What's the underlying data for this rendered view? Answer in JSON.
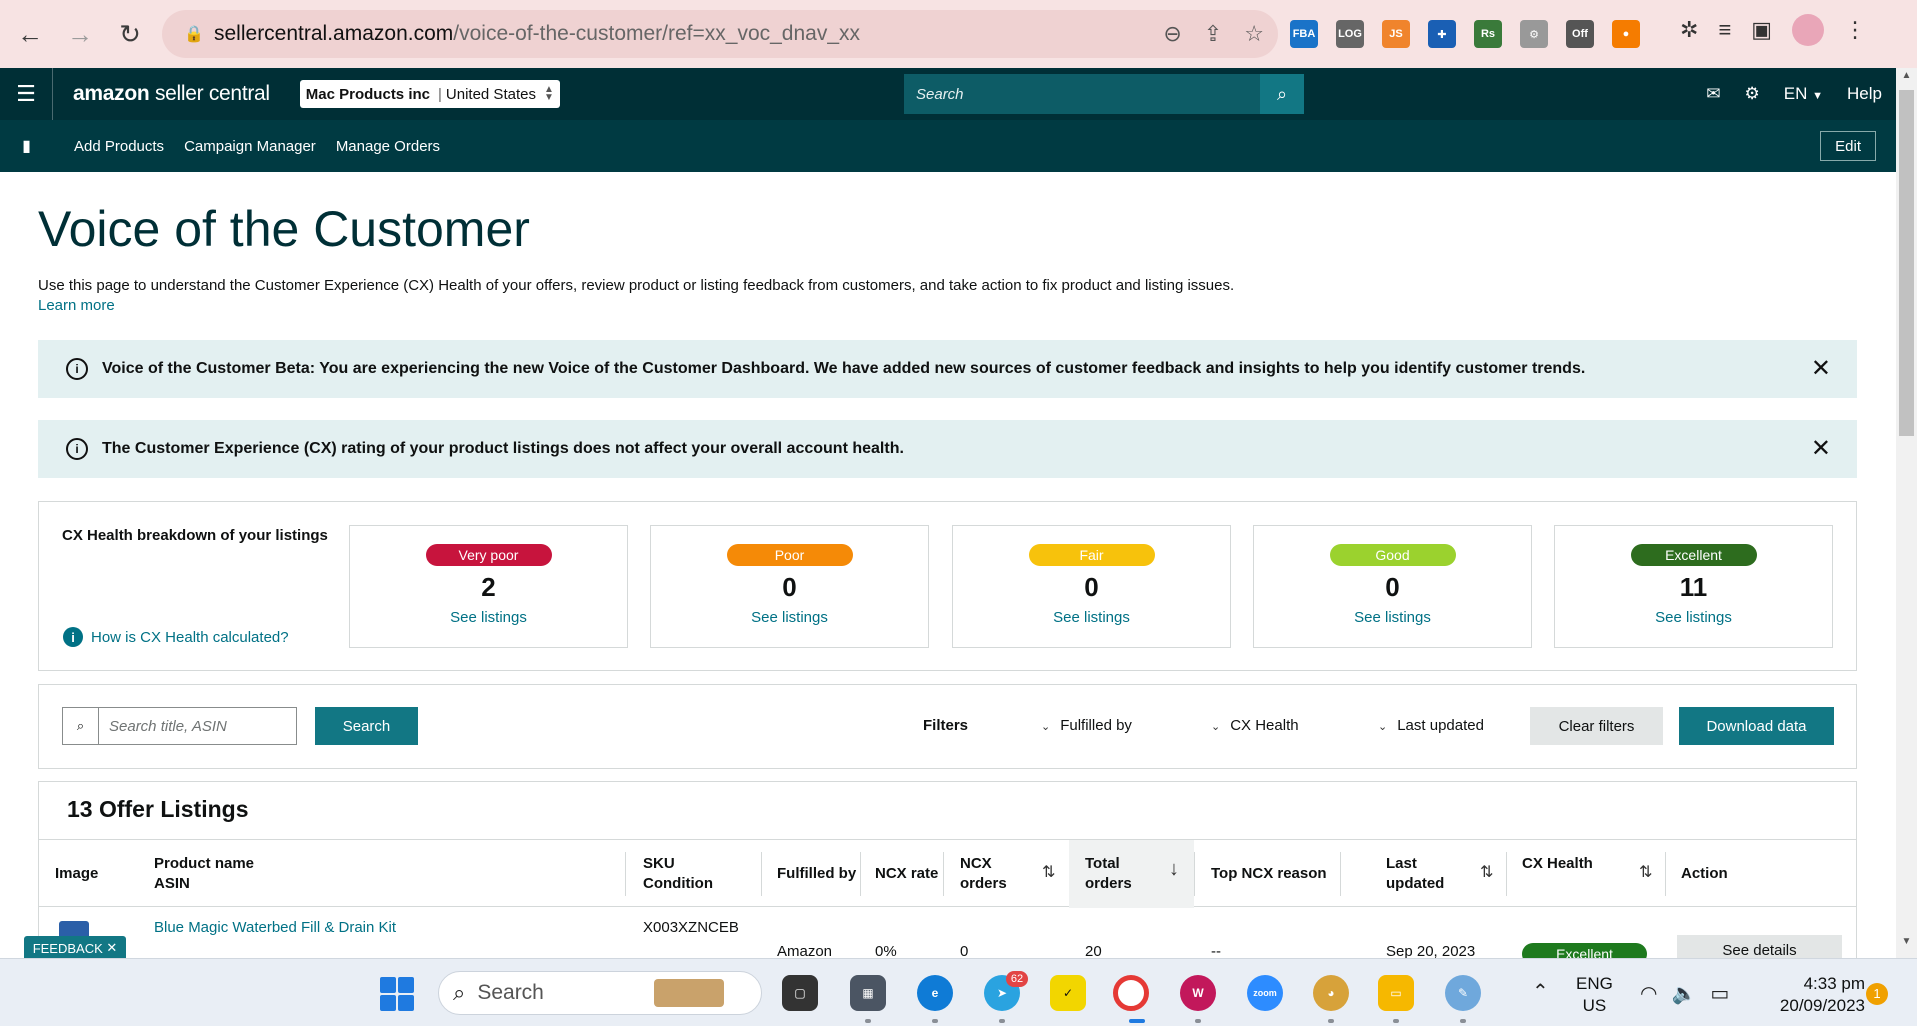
{
  "browser": {
    "url_host": "sellercentral.amazon.com",
    "url_path": "/voice-of-the-customer/ref=xx_voc_dnav_xx",
    "extensions": [
      {
        "name": "fba-extension",
        "label": "FBA",
        "color": "#1a73c8"
      },
      {
        "name": "login-extension",
        "label": "LOG",
        "color": "#666666"
      },
      {
        "name": "js-extension",
        "label": "JS",
        "color": "#f0842c"
      },
      {
        "name": "helper-extension",
        "label": "✚",
        "color": "#1a5fb4"
      },
      {
        "name": "rs-extension",
        "label": "Rs",
        "color": "#3a7a3a"
      },
      {
        "name": "gear-extension",
        "label": "⚙",
        "color": "#999999"
      },
      {
        "name": "off-extension",
        "label": "Off",
        "color": "#555555"
      },
      {
        "name": "circle-extension",
        "label": "●",
        "color": "#f57c00"
      }
    ]
  },
  "header": {
    "brand_left": "amazon",
    "brand_right": "seller central",
    "account_name": "Mac Products inc",
    "account_region": "United States",
    "search_placeholder": "Search",
    "language": "EN",
    "help": "Help"
  },
  "nav": {
    "links": [
      "Add Products",
      "Campaign Manager",
      "Manage Orders"
    ],
    "edit": "Edit"
  },
  "page": {
    "title": "Voice of the Customer",
    "intro": "Use this page to understand the Customer Experience (CX) Health of your offers, review product or listing feedback from customers, and take action to fix product and listing issues.",
    "learn_more": "Learn more"
  },
  "alerts": [
    {
      "text": "Voice of the Customer Beta: You are experiencing the new Voice of the Customer Dashboard. We have added new sources of customer feedback and insights to help you identify customer trends."
    },
    {
      "text": "The Customer Experience (CX) rating of your product listings does not affect your overall account health."
    }
  ],
  "cx_health": {
    "title": "CX Health breakdown of your listings",
    "how_link": "How is CX Health calculated?",
    "cards": [
      {
        "label": "Very poor",
        "count": "2",
        "link": "See listings",
        "color": "#c7143d"
      },
      {
        "label": "Poor",
        "count": "0",
        "link": "See listings",
        "color": "#f58a07"
      },
      {
        "label": "Fair",
        "count": "0",
        "link": "See listings",
        "color": "#f7c20c"
      },
      {
        "label": "Good",
        "count": "0",
        "link": "See listings",
        "color": "#9bd22e"
      },
      {
        "label": "Excellent",
        "count": "11",
        "link": "See listings",
        "color": "#2d6c1e"
      }
    ]
  },
  "filters": {
    "search_placeholder": "Search title, ASIN",
    "search_button": "Search",
    "label": "Filters",
    "fulfilled_by": "Fulfilled by",
    "cx_health": "CX Health",
    "last_updated": "Last updated",
    "clear": "Clear filters",
    "download": "Download data"
  },
  "listings": {
    "title": "13 Offer Listings",
    "columns": {
      "image": "Image",
      "product_name": "Product name",
      "asin": "ASIN",
      "sku": "SKU",
      "condition": "Condition",
      "fulfilled_by": "Fulfilled by",
      "ncx_rate": "NCX rate",
      "ncx_orders_1": "NCX",
      "ncx_orders_2": "orders",
      "total_orders_1": "Total",
      "total_orders_2": "orders",
      "top_ncx_reason": "Top NCX reason",
      "last_updated_1": "Last",
      "last_updated_2": "updated",
      "cx_health": "CX Health",
      "action": "Action"
    },
    "rows": [
      {
        "product_name": "Blue Magic Waterbed Fill & Drain Kit",
        "sku": "X003XZNCEB",
        "fulfilled_by": "Amazon",
        "ncx_rate": "0%",
        "ncx_orders": "0",
        "total_orders": "20",
        "top_ncx_reason": "--",
        "last_updated": "Sep 20, 2023",
        "cx_health": "Excellent",
        "action": "See details"
      }
    ]
  },
  "feedback": "FEEDBACK",
  "taskbar": {
    "search_placeholder": "Search",
    "lang_1": "ENG",
    "lang_2": "US",
    "time": "4:33 pm",
    "date": "20/09/2023",
    "telegram_badge": "62",
    "notifications": "1"
  }
}
